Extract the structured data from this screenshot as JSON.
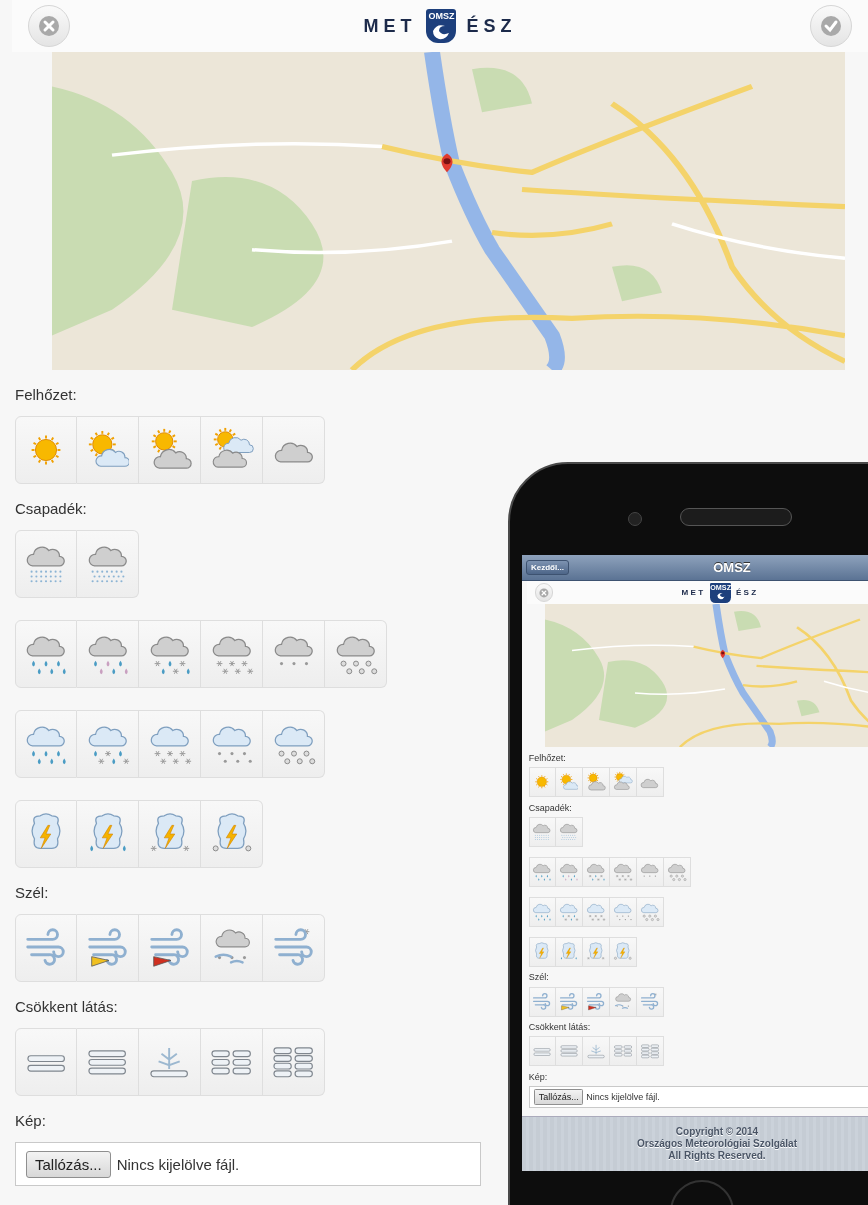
{
  "page": {
    "header": {
      "buttons": [
        {
          "kind": "close"
        },
        {
          "kind": "confirm"
        }
      ],
      "logo": {
        "left": "MET",
        "badge": "OMSZ",
        "right": "ÉSZ"
      }
    },
    "sections": [
      {
        "label": "Felhőzet:",
        "groups": [
          [
            {
              "kind": "sun"
            },
            {
              "kind": "sun-cloud"
            },
            {
              "kind": "sun-dark-cloud"
            },
            {
              "kind": "sun-two-clouds"
            },
            {
              "kind": "cloud"
            }
          ]
        ]
      },
      {
        "label": "Csapadék:",
        "groups": [
          [
            {
              "kind": "drizzle-fog"
            },
            {
              "kind": "freezing-fog"
            }
          ],
          [
            {
              "kind": "rain"
            },
            {
              "kind": "sleet"
            },
            {
              "kind": "rain-snow"
            },
            {
              "kind": "snow"
            },
            {
              "kind": "grains"
            },
            {
              "kind": "hail"
            }
          ],
          [
            {
              "kind": "shower-rain"
            },
            {
              "kind": "shower-sleet"
            },
            {
              "kind": "shower-snow"
            },
            {
              "kind": "shower-grains"
            },
            {
              "kind": "shower-hail"
            }
          ],
          [
            {
              "kind": "storm"
            },
            {
              "kind": "storm-rain"
            },
            {
              "kind": "storm-snow"
            },
            {
              "kind": "storm-hail"
            }
          ]
        ]
      },
      {
        "label": "Szél:",
        "groups": [
          [
            {
              "kind": "wind"
            },
            {
              "kind": "wind-yellow-flag"
            },
            {
              "kind": "wind-red-flag"
            },
            {
              "kind": "wind-cloud"
            },
            {
              "kind": "wind-snow"
            }
          ]
        ]
      },
      {
        "label": "Csökkent látás:",
        "groups": [
          [
            {
              "kind": "fog-two"
            },
            {
              "kind": "fog-three"
            },
            {
              "kind": "fog-ice"
            },
            {
              "kind": "fog-patches"
            },
            {
              "kind": "fog-dense"
            }
          ]
        ]
      }
    ],
    "image_field": {
      "label": "Kép:",
      "button": "Tallózás...",
      "status": "Nincs kijelölve fájl."
    }
  },
  "phone": {
    "nav": {
      "back": "Kezdől...",
      "title": "OMSZ"
    },
    "page": {
      "header": {
        "buttons": [
          {
            "kind": "close"
          }
        ],
        "logo": {
          "left": "MET",
          "badge": "OMSZ",
          "right": "ÉSZ"
        }
      },
      "sections": [
        {
          "label": "Felhőzet:",
          "groups": [
            [
              {
                "kind": "sun"
              },
              {
                "kind": "sun-cloud"
              },
              {
                "kind": "sun-dark-cloud"
              },
              {
                "kind": "sun-two-clouds"
              },
              {
                "kind": "cloud"
              }
            ]
          ]
        },
        {
          "label": "Csapadék:",
          "groups": [
            [
              {
                "kind": "drizzle-fog"
              },
              {
                "kind": "freezing-fog"
              }
            ],
            [
              {
                "kind": "rain"
              },
              {
                "kind": "sleet"
              },
              {
                "kind": "rain-snow"
              },
              {
                "kind": "snow"
              },
              {
                "kind": "grains"
              },
              {
                "kind": "hail"
              }
            ],
            [
              {
                "kind": "shower-rain"
              },
              {
                "kind": "shower-sleet"
              },
              {
                "kind": "shower-snow"
              },
              {
                "kind": "shower-grains"
              },
              {
                "kind": "shower-hail"
              }
            ],
            [
              {
                "kind": "storm"
              },
              {
                "kind": "storm-rain"
              },
              {
                "kind": "storm-snow"
              },
              {
                "kind": "storm-hail"
              }
            ]
          ]
        },
        {
          "label": "Szél:",
          "groups": [
            [
              {
                "kind": "wind"
              },
              {
                "kind": "wind-yellow-flag"
              },
              {
                "kind": "wind-red-flag"
              },
              {
                "kind": "wind-cloud"
              },
              {
                "kind": "wind-snow"
              }
            ]
          ]
        },
        {
          "label": "Csökkent látás:",
          "groups": [
            [
              {
                "kind": "fog-two"
              },
              {
                "kind": "fog-three"
              },
              {
                "kind": "fog-ice"
              },
              {
                "kind": "fog-patches"
              },
              {
                "kind": "fog-dense"
              }
            ]
          ]
        }
      ],
      "image_field": {
        "label": "Kép:",
        "button": "Tallózás...",
        "status": "Nincs kijelölve fájl."
      }
    },
    "footer": [
      "Copyright © 2014",
      "Országos Meteorológiai Szolgálat",
      "All Rights Reserved."
    ]
  }
}
